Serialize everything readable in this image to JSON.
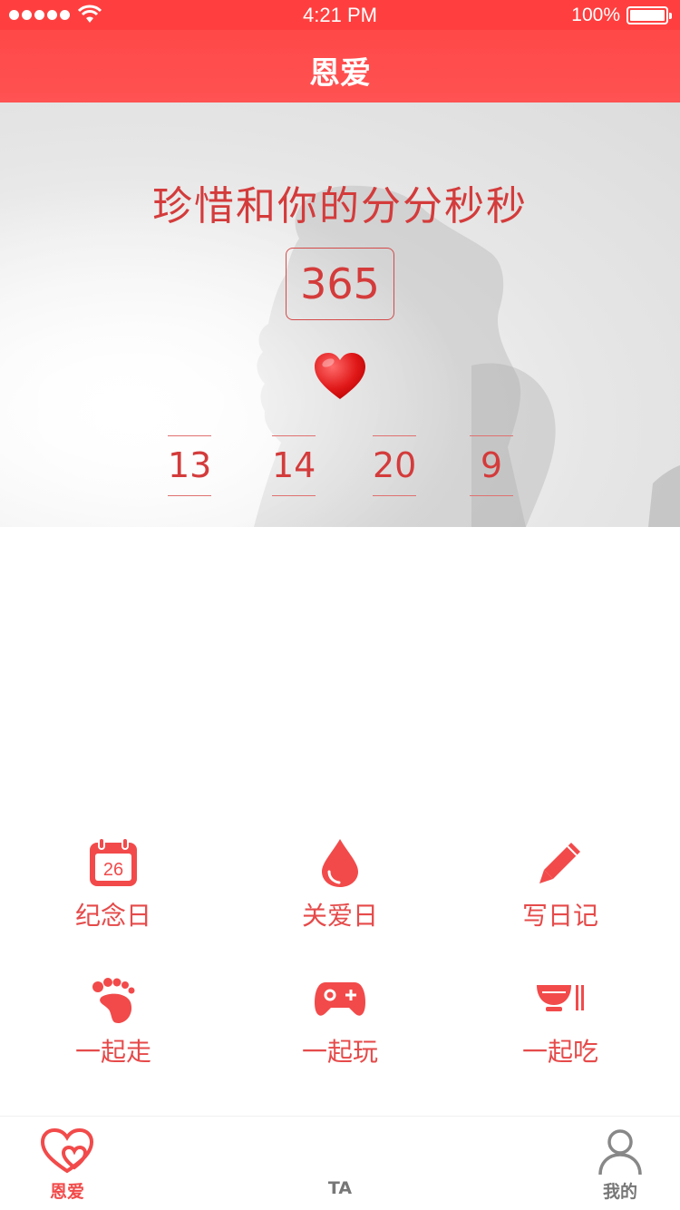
{
  "status_bar": {
    "time": "4:21 PM",
    "battery": "100%"
  },
  "nav": {
    "title": "恩爱"
  },
  "hero": {
    "title": "珍惜和你的分分秒秒",
    "days": "365",
    "time_parts": [
      "13",
      "14",
      "20",
      "9"
    ]
  },
  "features": [
    {
      "label": "纪念日",
      "icon": "calendar-icon",
      "calendar_day": "26"
    },
    {
      "label": "关爱日",
      "icon": "drop-icon"
    },
    {
      "label": "写日记",
      "icon": "pencil-icon"
    },
    {
      "label": "一起走",
      "icon": "footprint-icon"
    },
    {
      "label": "一起玩",
      "icon": "gamepad-icon"
    },
    {
      "label": "一起吃",
      "icon": "bowl-chopsticks-icon"
    }
  ],
  "tabs": [
    {
      "label": "恩爱",
      "icon": "hearts-icon",
      "active": true
    },
    {
      "label": "TA",
      "active": false
    },
    {
      "label": "我的",
      "icon": "user-icon",
      "active": false
    }
  ],
  "colors": {
    "accent": "#ff4848",
    "text_red": "#e64a4a",
    "inactive": "#777777"
  }
}
